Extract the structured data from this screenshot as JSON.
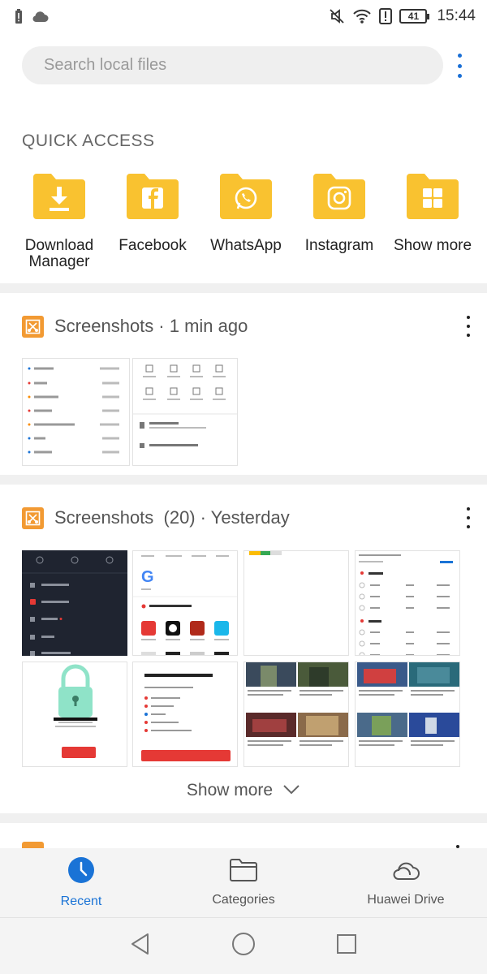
{
  "status_bar": {
    "battery": "41",
    "time": "15:44",
    "icons": [
      "battery-alert-icon",
      "cloud-icon",
      "mute-icon",
      "wifi-icon",
      "alert-icon",
      "battery-icon"
    ]
  },
  "search": {
    "placeholder": "Search local files"
  },
  "quick_access": {
    "title": "QUICK ACCESS",
    "items": [
      {
        "label": "Download\nManager",
        "icon": "download-icon"
      },
      {
        "label": "Facebook",
        "icon": "facebook-icon"
      },
      {
        "label": "WhatsApp",
        "icon": "whatsapp-icon"
      },
      {
        "label": "Instagram",
        "icon": "instagram-icon"
      },
      {
        "label": "Show more",
        "icon": "grid-icon"
      }
    ],
    "folder_color": "#f9c230"
  },
  "albums": [
    {
      "title": "Screenshots",
      "time": "· 1 min ago"
    },
    {
      "title": "Screenshots  (20)",
      "time": "· Yesterday"
    }
  ],
  "show_more": {
    "label": "Show more"
  },
  "bottom_nav": {
    "items": [
      {
        "label": "Recent",
        "icon": "clock-icon",
        "active": true
      },
      {
        "label": "Categories",
        "icon": "folder-icon",
        "active": false
      },
      {
        "label": "Huawei Drive",
        "icon": "cloud-icon",
        "active": false
      }
    ],
    "active_color": "#1a73d6"
  },
  "system_nav": [
    "back-icon",
    "home-icon",
    "recents-icon"
  ],
  "accent_color": "#f29a33"
}
